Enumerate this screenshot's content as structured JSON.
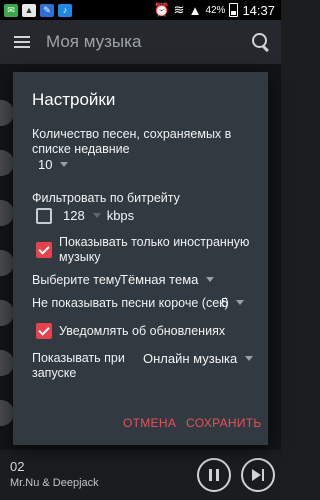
{
  "status_bar": {
    "battery_percent": "42%",
    "time": "14:37"
  },
  "app_bar": {
    "title": "Моя музыка"
  },
  "now_playing": {
    "track_number": "02",
    "artist": "Mr.Nu & Deepjack"
  },
  "dialog": {
    "title": "Настройки",
    "recent_count_label": "Количество песен, сохраняемых в списке недавние",
    "recent_count_value": "10",
    "bitrate_label": "Фильтровать по битрейту",
    "bitrate_checked": false,
    "bitrate_value": "128",
    "bitrate_unit": "kbps",
    "foreign_label": "Показывать только иностранную музыку",
    "foreign_checked": true,
    "theme_label": "Выберите тему",
    "theme_value": "Тёмная тема",
    "min_length_label": "Не показывать песни короче (сек)",
    "min_length_value": "5",
    "updates_label": "Уведомлять об обновлениях",
    "updates_checked": true,
    "startup_label": "Показывать при запуске",
    "startup_value": "Онлайн музыка",
    "cancel_label": "ОТМЕНА",
    "save_label": "СОХРАНИТЬ"
  },
  "colors": {
    "accent": "#e6424d",
    "dialog_bg": "#313a40",
    "app_bar_bg": "#25292d"
  }
}
